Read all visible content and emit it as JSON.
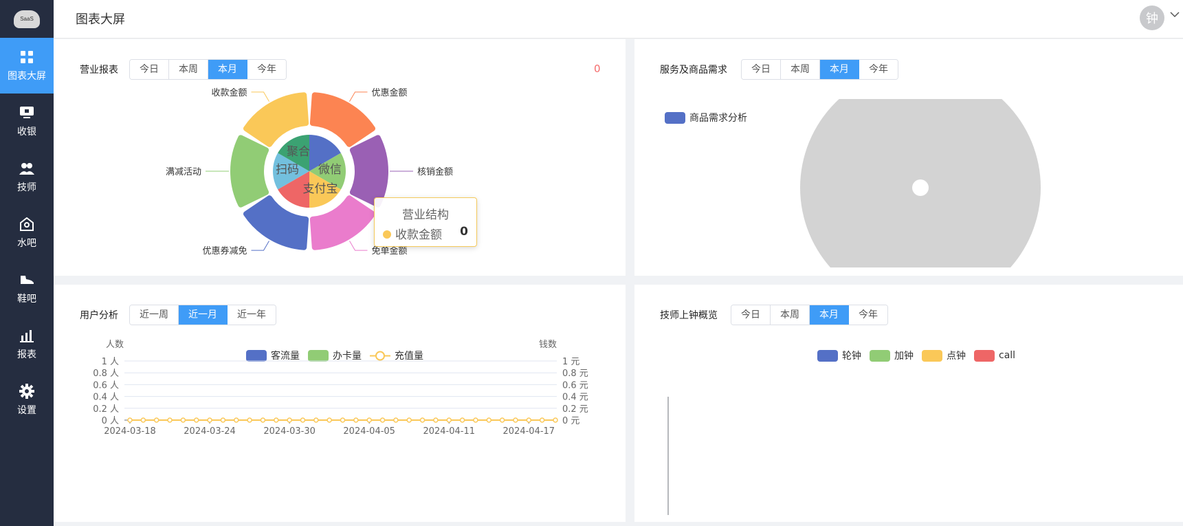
{
  "logo_text": "SaaS",
  "header": {
    "title": "图表大屏",
    "avatar": "钟"
  },
  "sidebar": {
    "items": [
      {
        "label": "图表大屏",
        "icon": "dashboard-grid-icon",
        "active": true
      },
      {
        "label": "收银",
        "icon": "cashier-monitor-icon"
      },
      {
        "label": "技师",
        "icon": "technicians-people-icon"
      },
      {
        "label": "水吧",
        "icon": "water-bar-icon"
      },
      {
        "label": "鞋吧",
        "icon": "shoe-icon"
      },
      {
        "label": "报表",
        "icon": "bar-chart-icon"
      },
      {
        "label": "设置",
        "icon": "gear-icon"
      }
    ]
  },
  "panels": {
    "revenue": {
      "title": "营业报表",
      "tabs": [
        "今日",
        "本周",
        "本月",
        "今年"
      ],
      "active_tab": "本月",
      "count": "0",
      "tooltip": {
        "title": "营业结构",
        "label": "收款金额",
        "value": "0"
      }
    },
    "service": {
      "title": "服务及商品需求",
      "tabs": [
        "今日",
        "本周",
        "本月",
        "今年"
      ],
      "active_tab": "本月",
      "legend": "商品需求分析"
    },
    "users": {
      "title": "用户分析",
      "tabs": [
        "近一周",
        "近一月",
        "近一年"
      ],
      "active_tab": "近一月",
      "legend": [
        "客流量",
        "办卡量",
        "充值量"
      ],
      "left_axis_name": "人数",
      "right_axis_name": "钱数"
    },
    "tech": {
      "title": "技师上钟概览",
      "tabs": [
        "今日",
        "本周",
        "本月",
        "今年"
      ],
      "active_tab": "本月",
      "legend": [
        "轮钟",
        "加钟",
        "点钟",
        "call"
      ]
    }
  },
  "chart_data": [
    {
      "type": "pie",
      "title": "营业结构",
      "categories": [
        "优惠金额",
        "核销金额",
        "免单金额",
        "优惠券减免",
        "满减活动",
        "收款金额"
      ],
      "values": [
        0,
        0,
        0,
        0,
        0,
        0
      ],
      "colors": [
        "#fc8452",
        "#9a60b4",
        "#ea7ccc",
        "#5470c6",
        "#91cc75",
        "#fac858"
      ],
      "inner_categories": [
        "聚合",
        "微信",
        "支付宝",
        "扫码"
      ],
      "inner_values": [
        0,
        0,
        0,
        0,
        0,
        0
      ],
      "inner_colors": [
        "#5470c6",
        "#91cc75",
        "#fac858",
        "#ee6666",
        "#73c0de",
        "#3ba272"
      ]
    },
    {
      "type": "pie",
      "title": "",
      "series": [
        {
          "name": "商品需求分析",
          "values": []
        }
      ],
      "colors": [
        "#5470c6",
        "#d3d3d3"
      ]
    },
    {
      "type": "line",
      "x": [
        "2024-03-18",
        "2024-03-24",
        "2024-03-30",
        "2024-04-05",
        "2024-04-11",
        "2024-04-17"
      ],
      "series": [
        {
          "name": "客流量",
          "values": [
            0,
            0,
            0,
            0,
            0,
            0,
            0,
            0,
            0,
            0,
            0,
            0,
            0,
            0,
            0,
            0,
            0,
            0,
            0,
            0,
            0,
            0,
            0,
            0,
            0,
            0,
            0,
            0,
            0,
            0,
            0,
            0,
            0
          ]
        },
        {
          "name": "办卡量",
          "values": [
            0,
            0,
            0,
            0,
            0,
            0,
            0,
            0,
            0,
            0,
            0,
            0,
            0,
            0,
            0,
            0,
            0,
            0,
            0,
            0,
            0,
            0,
            0,
            0,
            0,
            0,
            0,
            0,
            0,
            0,
            0,
            0,
            0
          ]
        },
        {
          "name": "充值量",
          "values": [
            0,
            0,
            0,
            0,
            0,
            0,
            0,
            0,
            0,
            0,
            0,
            0,
            0,
            0,
            0,
            0,
            0,
            0,
            0,
            0,
            0,
            0,
            0,
            0,
            0,
            0,
            0,
            0,
            0,
            0,
            0,
            0,
            0
          ]
        }
      ],
      "left_ticks": [
        "0 人",
        "0.2 人",
        "0.4 人",
        "0.6 人",
        "0.8 人",
        "1 人"
      ],
      "right_ticks": [
        "0 元",
        "0.2 元",
        "0.4 元",
        "0.6 元",
        "0.8 元",
        "1 元"
      ],
      "ylabel": "人数",
      "y2label": "钱数",
      "ylim": [
        0,
        1
      ],
      "colors": [
        "#5470c6",
        "#91cc75",
        "#fac858"
      ]
    },
    {
      "type": "bar",
      "series": [
        {
          "name": "轮钟",
          "values": []
        },
        {
          "name": "加钟",
          "values": []
        },
        {
          "name": "点钟",
          "values": []
        },
        {
          "name": "call",
          "values": []
        }
      ],
      "colors": [
        "#5470c6",
        "#91cc75",
        "#fac858",
        "#ee6666"
      ]
    }
  ]
}
